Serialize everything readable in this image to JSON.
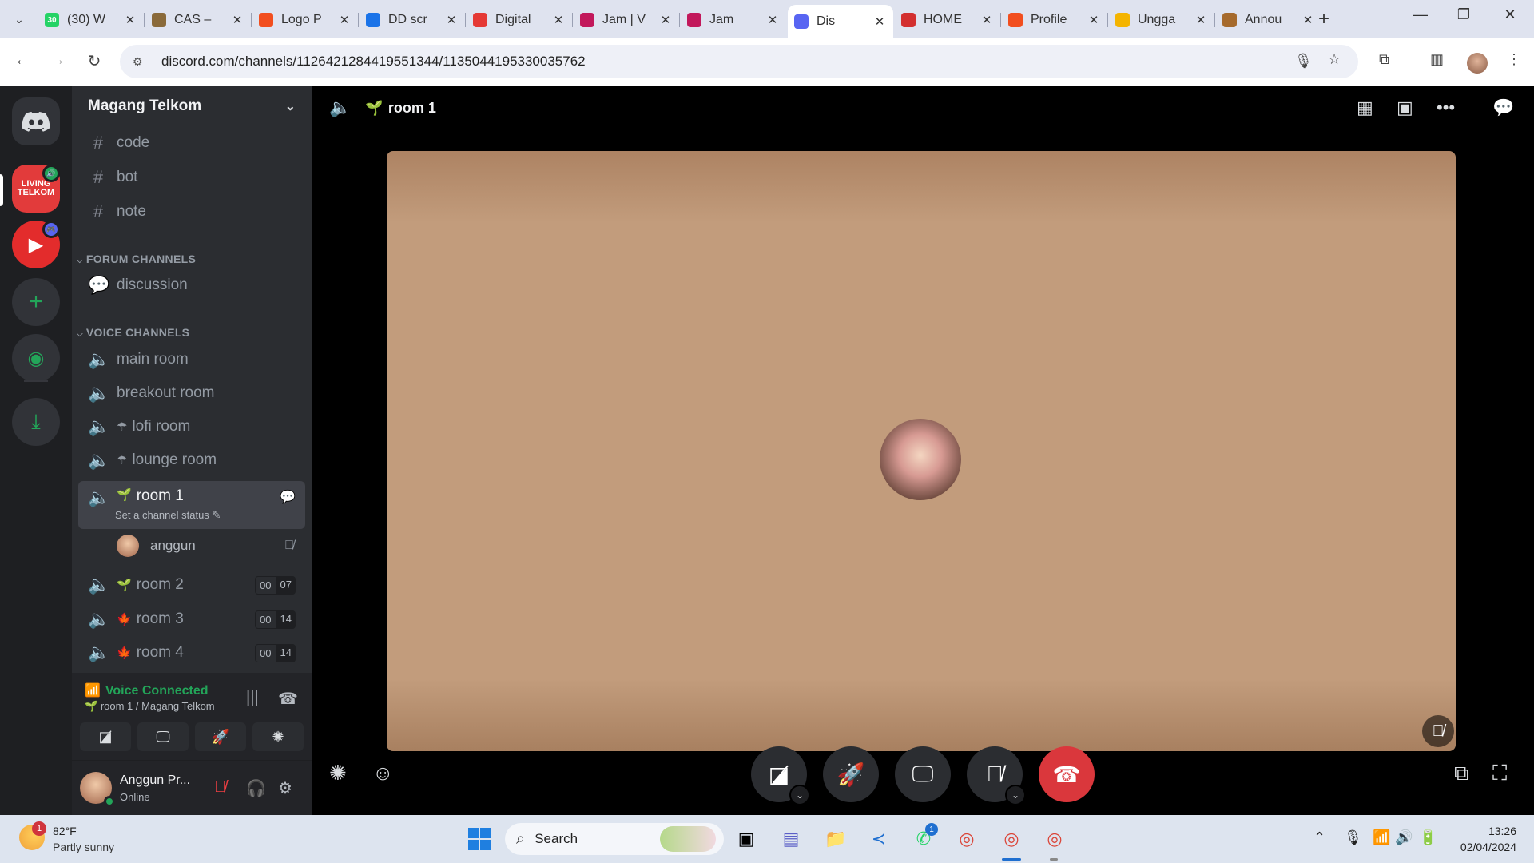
{
  "browser": {
    "tabs": [
      {
        "title": "(30) W",
        "favicon_color": "#25d366",
        "favicon_text": "30"
      },
      {
        "title": "CAS –",
        "favicon_color": "#8a6a3a",
        "favicon_text": ""
      },
      {
        "title": "Logo P",
        "favicon_color": "#f24e1e",
        "favicon_text": ""
      },
      {
        "title": "DD scr",
        "favicon_color": "#1a73e8",
        "favicon_text": ""
      },
      {
        "title": "Digital",
        "favicon_color": "#e53935",
        "favicon_text": ""
      },
      {
        "title": "Jam | V",
        "favicon_color": "#c2185b",
        "favicon_text": ""
      },
      {
        "title": "Jam",
        "favicon_color": "#c2185b",
        "favicon_text": ""
      },
      {
        "title": "Dis",
        "favicon_color": "#5865f2",
        "favicon_text": ""
      },
      {
        "title": "HOME",
        "favicon_color": "#d32f2f",
        "favicon_text": ""
      },
      {
        "title": "Profile",
        "favicon_color": "#f24e1e",
        "favicon_text": ""
      },
      {
        "title": "Ungga",
        "favicon_color": "#f4b400",
        "favicon_text": ""
      },
      {
        "title": "Annou",
        "favicon_color": "#a66a2c",
        "favicon_text": ""
      }
    ],
    "active_tab_index": 7,
    "new_tab_label": "+",
    "url": "discord.com/channels/1126421284419551344/1135044195330035762"
  },
  "discord": {
    "server_name": "Magang Telkom",
    "telkom_guild_label": "LIVING TELKOM",
    "text_channels": [
      "code",
      "bot",
      "note"
    ],
    "forum_category": "FORUM CHANNELS",
    "forum_channels": [
      "discussion"
    ],
    "voice_category": "VOICE CHANNELS",
    "voice_channels": [
      {
        "name": "main room",
        "emoji": ""
      },
      {
        "name": "breakout room",
        "emoji": ""
      },
      {
        "name": "lofi room",
        "emoji": "☂"
      },
      {
        "name": "lounge room",
        "emoji": "☂"
      }
    ],
    "active_channel": {
      "name": "room 1",
      "emoji": "🌱",
      "status_placeholder": "Set a channel status",
      "members": [
        {
          "name": "anggun"
        }
      ]
    },
    "other_rooms": [
      {
        "name": "room 2",
        "emoji": "🌱",
        "timer_a": "00",
        "timer_b": "07"
      },
      {
        "name": "room 3",
        "emoji": "🍁",
        "timer_a": "00",
        "timer_b": "14"
      },
      {
        "name": "room 4",
        "emoji": "🍁",
        "timer_a": "00",
        "timer_b": "14"
      }
    ],
    "voice_panel": {
      "status": "Voice Connected",
      "subtitle": "room 1 / Magang Telkom",
      "subtitle_emoji": "🌱"
    },
    "user": {
      "name": "Anggun Pr...",
      "status": "Online"
    },
    "stage": {
      "channel_name": "room 1",
      "emoji": "🌱"
    }
  },
  "taskbar": {
    "weather_temp": "82°F",
    "weather_desc": "Partly sunny",
    "weather_badge": "1",
    "search_label": "Search",
    "whatsapp_badge": "1",
    "time": "13:26",
    "date": "02/04/2024"
  },
  "colors": {
    "discord_green": "#23a559",
    "end_call_red": "#da373c",
    "blurple": "#5865f2"
  }
}
